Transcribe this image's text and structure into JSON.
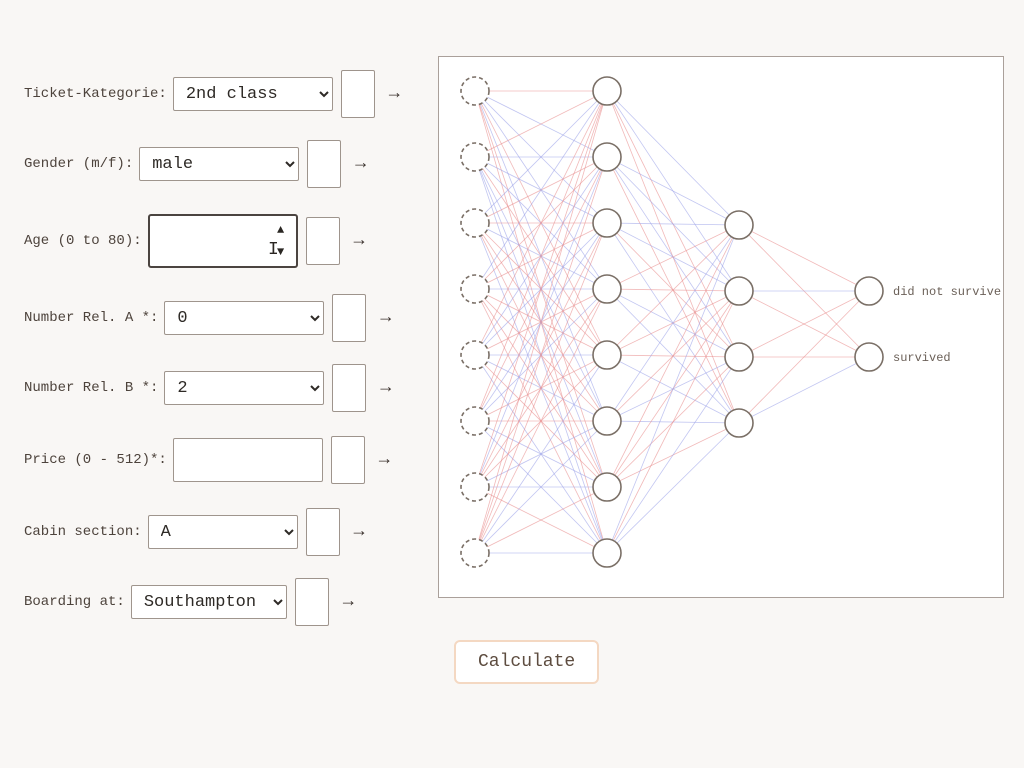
{
  "form": {
    "ticket": {
      "label": "Ticket-Kategorie:",
      "value": "2nd class"
    },
    "gender": {
      "label": "Gender (m/f):",
      "value": "male"
    },
    "age": {
      "label": "Age (0 to 80):",
      "value": ""
    },
    "relA": {
      "label": "Number Rel. A *:",
      "value": "0"
    },
    "relB": {
      "label": "Number Rel. B *:",
      "value": "2"
    },
    "price": {
      "label": "Price (0 - 512)*:",
      "value": ""
    },
    "cabin": {
      "label": "Cabin section:",
      "value": "A"
    },
    "boarding": {
      "label": "Boarding at:",
      "value": "Southampton"
    }
  },
  "outputs": {
    "o1": "did not survive",
    "o2": "survived"
  },
  "button": {
    "calculate": "Calculate"
  },
  "glyphs": {
    "arrow": "→",
    "spin_up": "▲",
    "spin_down": "▼"
  },
  "net": {
    "layers": [
      8,
      8,
      4,
      2
    ],
    "colors": {
      "red": "#e88a8a",
      "blue": "#9aa0e8"
    }
  }
}
